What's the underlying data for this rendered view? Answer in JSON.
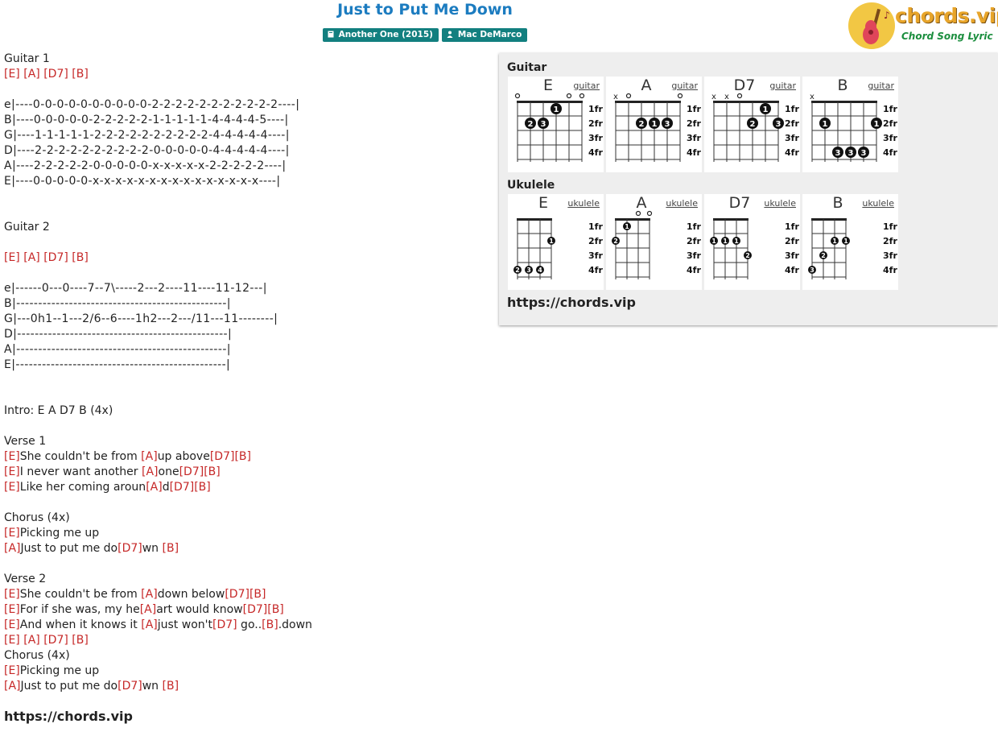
{
  "title": "Just to Put Me Down",
  "badges": [
    {
      "icon": "book-icon",
      "text": "Another One (2015)"
    },
    {
      "icon": "user-icon",
      "text": "Mac DeMarco"
    }
  ],
  "logo": {
    "brand": "chords.vip",
    "tagline": "Chord Song Lyric"
  },
  "song_lines": [
    {
      "t": "text",
      "parts": [
        {
          "txt": "Guitar 1"
        }
      ]
    },
    {
      "t": "text",
      "parts": [
        {
          "ch": "[E]"
        },
        {
          "txt": " "
        },
        {
          "ch": "[A]"
        },
        {
          "txt": " "
        },
        {
          "ch": "[D7]"
        },
        {
          "txt": " "
        },
        {
          "ch": "[B]"
        }
      ]
    },
    {
      "t": "blank"
    },
    {
      "t": "tab",
      "parts": [
        {
          "txt": "e|----0-0-0-0-0-0-0-0-0-0-2-2-2-2-2-2-2-2-2-2-2----|"
        }
      ]
    },
    {
      "t": "tab",
      "parts": [
        {
          "txt": "B|----0-0-0-0-0-2-2-2-2-2-1-1-1-1-1-4-4-4-4-5----|"
        }
      ]
    },
    {
      "t": "tab",
      "parts": [
        {
          "txt": "G|----1-1-1-1-1-2-2-2-2-2-2-2-2-2-2-4-4-4-4-4----|"
        }
      ]
    },
    {
      "t": "tab",
      "parts": [
        {
          "txt": "D|----2-2-2-2-2-2-2-2-2-2-0-0-0-0-0-4-4-4-4-4----|"
        }
      ]
    },
    {
      "t": "tab",
      "parts": [
        {
          "txt": "A|----2-2-2-2-2-0-0-0-0-0-x-x-x-x-x-2-2-2-2-2----|"
        }
      ]
    },
    {
      "t": "tab",
      "parts": [
        {
          "txt": "E|----0-0-0-0-0-x-x-x-x-x-x-x-x-x-x-x-x-x-x-x----|"
        }
      ]
    },
    {
      "t": "blank"
    },
    {
      "t": "blank"
    },
    {
      "t": "text",
      "parts": [
        {
          "txt": "Guitar 2"
        }
      ]
    },
    {
      "t": "blank"
    },
    {
      "t": "text",
      "parts": [
        {
          "ch": "[E]"
        },
        {
          "txt": " "
        },
        {
          "ch": "[A]"
        },
        {
          "txt": " "
        },
        {
          "ch": "[D7]"
        },
        {
          "txt": " "
        },
        {
          "ch": "[B]"
        }
      ]
    },
    {
      "t": "blank"
    },
    {
      "t": "tab",
      "parts": [
        {
          "txt": "e|------0---0----7--7\\-----2---2----11----11-12---|"
        }
      ]
    },
    {
      "t": "tab",
      "parts": [
        {
          "txt": "B|------------------------------------------------|"
        }
      ]
    },
    {
      "t": "tab",
      "parts": [
        {
          "txt": "G|---0h1--1---2/6--6----1h2---2---/11---11--------|"
        }
      ]
    },
    {
      "t": "tab",
      "parts": [
        {
          "txt": "D|------------------------------------------------|"
        }
      ]
    },
    {
      "t": "tab",
      "parts": [
        {
          "txt": "A|------------------------------------------------|"
        }
      ]
    },
    {
      "t": "tab",
      "parts": [
        {
          "txt": "E|------------------------------------------------|"
        }
      ]
    },
    {
      "t": "blank"
    },
    {
      "t": "blank"
    },
    {
      "t": "text",
      "parts": [
        {
          "txt": "Intro: E A D7 B (4x)"
        }
      ]
    },
    {
      "t": "blank"
    },
    {
      "t": "text",
      "parts": [
        {
          "txt": "Verse 1"
        }
      ]
    },
    {
      "t": "text",
      "parts": [
        {
          "ch": "[E]"
        },
        {
          "txt": "She couldn't be from "
        },
        {
          "ch": "[A]"
        },
        {
          "txt": "up above"
        },
        {
          "ch": "[D7]"
        },
        {
          "ch": "[B]"
        }
      ]
    },
    {
      "t": "text",
      "parts": [
        {
          "ch": "[E]"
        },
        {
          "txt": "I never want another "
        },
        {
          "ch": "[A]"
        },
        {
          "txt": "one"
        },
        {
          "ch": "[D7]"
        },
        {
          "ch": "[B]"
        }
      ]
    },
    {
      "t": "text",
      "parts": [
        {
          "ch": "[E]"
        },
        {
          "txt": "Like her coming aroun"
        },
        {
          "ch": "[A]"
        },
        {
          "txt": "d"
        },
        {
          "ch": "[D7]"
        },
        {
          "ch": "[B]"
        }
      ]
    },
    {
      "t": "blank"
    },
    {
      "t": "text",
      "parts": [
        {
          "txt": "Chorus (4x)"
        }
      ]
    },
    {
      "t": "text",
      "parts": [
        {
          "ch": "[E]"
        },
        {
          "txt": "Picking me up"
        }
      ]
    },
    {
      "t": "text",
      "parts": [
        {
          "ch": "[A]"
        },
        {
          "txt": "Just to put me do"
        },
        {
          "ch": "[D7]"
        },
        {
          "txt": "wn "
        },
        {
          "ch": "[B]"
        }
      ]
    },
    {
      "t": "blank"
    },
    {
      "t": "text",
      "parts": [
        {
          "txt": "Verse 2"
        }
      ]
    },
    {
      "t": "text",
      "parts": [
        {
          "ch": "[E]"
        },
        {
          "txt": "She couldn't be from "
        },
        {
          "ch": "[A]"
        },
        {
          "txt": "down below"
        },
        {
          "ch": "[D7]"
        },
        {
          "ch": "[B]"
        }
      ]
    },
    {
      "t": "text",
      "parts": [
        {
          "ch": "[E]"
        },
        {
          "txt": "For if she was, my he"
        },
        {
          "ch": "[A]"
        },
        {
          "txt": "art would know"
        },
        {
          "ch": "[D7]"
        },
        {
          "ch": "[B]"
        }
      ]
    },
    {
      "t": "text",
      "parts": [
        {
          "ch": "[E]"
        },
        {
          "txt": "And when it knows it "
        },
        {
          "ch": "[A]"
        },
        {
          "txt": "just won't"
        },
        {
          "ch": "[D7]"
        },
        {
          "txt": " go.."
        },
        {
          "ch": "[B]"
        },
        {
          "txt": ".down"
        }
      ]
    },
    {
      "t": "text",
      "parts": [
        {
          "ch": "[E]"
        },
        {
          "txt": " "
        },
        {
          "ch": "[A]"
        },
        {
          "txt": " "
        },
        {
          "ch": "[D7]"
        },
        {
          "txt": " "
        },
        {
          "ch": "[B]"
        }
      ]
    },
    {
      "t": "text",
      "parts": [
        {
          "txt": "Chorus (4x)"
        }
      ]
    },
    {
      "t": "text",
      "parts": [
        {
          "ch": "[E]"
        },
        {
          "txt": "Picking me up"
        }
      ]
    },
    {
      "t": "text",
      "parts": [
        {
          "ch": "[A]"
        },
        {
          "txt": "Just to put me do"
        },
        {
          "ch": "[D7]"
        },
        {
          "txt": "wn "
        },
        {
          "ch": "[B]"
        }
      ]
    }
  ],
  "song_url": "https://chords.vip",
  "chord_panel": {
    "guitar_label": "Guitar",
    "ukulele_label": "Ukulele",
    "url": "https://chords.vip",
    "fret_labels": [
      "1fr",
      "2fr",
      "3fr",
      "4fr"
    ],
    "guitar_chords": [
      {
        "name": "E",
        "type": "guitar",
        "marks": [
          "o",
          "",
          "",
          "",
          "o",
          "o"
        ],
        "dots": [
          {
            "s": 4,
            "f": 1,
            "n": "1"
          },
          {
            "s": 2,
            "f": 2,
            "n": "2"
          },
          {
            "s": 3,
            "f": 2,
            "n": "3"
          }
        ]
      },
      {
        "name": "A",
        "type": "guitar",
        "marks": [
          "x",
          "o",
          "",
          "",
          "",
          "o"
        ],
        "dots": [
          {
            "s": 3,
            "f": 2,
            "n": "2"
          },
          {
            "s": 4,
            "f": 2,
            "n": "1"
          },
          {
            "s": 5,
            "f": 2,
            "n": "3"
          }
        ]
      },
      {
        "name": "D7",
        "type": "guitar",
        "marks": [
          "x",
          "x",
          "o",
          "",
          "",
          ""
        ],
        "dots": [
          {
            "s": 5,
            "f": 1,
            "n": "1"
          },
          {
            "s": 4,
            "f": 2,
            "n": "2"
          },
          {
            "s": 6,
            "f": 2,
            "n": "3"
          }
        ]
      },
      {
        "name": "B",
        "type": "guitar",
        "marks": [
          "x",
          "",
          "",
          "",
          "",
          ""
        ],
        "dots": [
          {
            "s": 2,
            "f": 2,
            "n": "1"
          },
          {
            "s": 6,
            "f": 2,
            "n": "1"
          },
          {
            "s": 3,
            "f": 4,
            "n": "3"
          },
          {
            "s": 4,
            "f": 4,
            "n": "3"
          },
          {
            "s": 5,
            "f": 4,
            "n": "3"
          }
        ]
      }
    ],
    "ukulele_chords": [
      {
        "name": "E",
        "type": "ukulele",
        "marks": [
          "",
          "",
          "",
          ""
        ],
        "dots": [
          {
            "s": 4,
            "f": 2,
            "n": "1"
          },
          {
            "s": 1,
            "f": 4,
            "n": "2"
          },
          {
            "s": 2,
            "f": 4,
            "n": "3"
          },
          {
            "s": 3,
            "f": 4,
            "n": "4"
          }
        ]
      },
      {
        "name": "A",
        "type": "ukulele",
        "marks": [
          "",
          "",
          "o",
          "o"
        ],
        "dots": [
          {
            "s": 2,
            "f": 1,
            "n": "1"
          },
          {
            "s": 1,
            "f": 2,
            "n": "2"
          }
        ]
      },
      {
        "name": "D7",
        "type": "ukulele",
        "marks": [
          "",
          "",
          "",
          ""
        ],
        "dots": [
          {
            "s": 1,
            "f": 2,
            "n": "1"
          },
          {
            "s": 2,
            "f": 2,
            "n": "1"
          },
          {
            "s": 3,
            "f": 2,
            "n": "1"
          },
          {
            "s": 4,
            "f": 3,
            "n": "2"
          }
        ]
      },
      {
        "name": "B",
        "type": "ukulele",
        "marks": [
          "",
          "",
          "",
          ""
        ],
        "dots": [
          {
            "s": 3,
            "f": 2,
            "n": "1"
          },
          {
            "s": 4,
            "f": 2,
            "n": "1"
          },
          {
            "s": 2,
            "f": 3,
            "n": "2"
          },
          {
            "s": 1,
            "f": 4,
            "n": "3"
          }
        ]
      }
    ]
  }
}
